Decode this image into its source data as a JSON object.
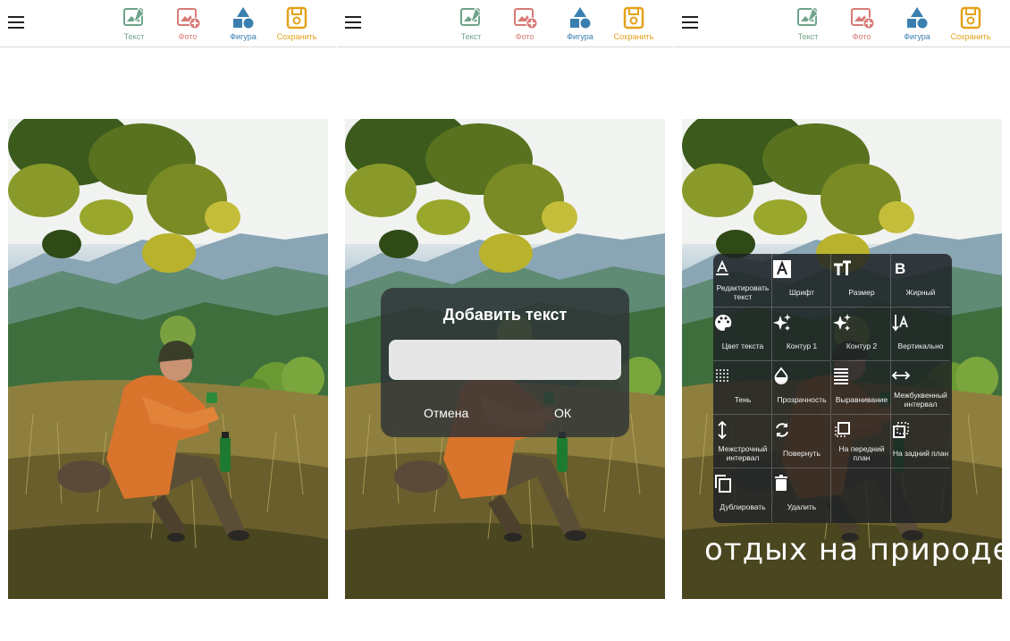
{
  "toolbar": {
    "text_label": "Текст",
    "photo_label": "Фото",
    "shape_label": "Фигура",
    "save_label": "Сохранить",
    "colors": {
      "text": "#6fa48a",
      "photo": "#d77b76",
      "shape": "#3a7fb0",
      "save": "#e3a21a"
    }
  },
  "dialog": {
    "title": "Добавить текст",
    "input_value": "",
    "cancel_label": "Отмена",
    "ok_label": "ОК"
  },
  "menu": {
    "items": [
      {
        "label": "Редактировать текст",
        "icon": "edit-text-icon"
      },
      {
        "label": "Шрифт",
        "icon": "font-icon"
      },
      {
        "label": "Размер",
        "icon": "text-size-icon"
      },
      {
        "label": "Жирный",
        "icon": "bold-icon"
      },
      {
        "label": "Цвет текста",
        "icon": "palette-icon"
      },
      {
        "label": "Контур 1",
        "icon": "sparkle-icon"
      },
      {
        "label": "Контур 2",
        "icon": "sparkle-icon"
      },
      {
        "label": "Вертикально",
        "icon": "vertical-text-icon"
      },
      {
        "label": "Тень",
        "icon": "shadow-icon"
      },
      {
        "label": "Прозрачность",
        "icon": "opacity-icon"
      },
      {
        "label": "Выравнивание",
        "icon": "align-icon"
      },
      {
        "label": "Межбуквенный интервал",
        "icon": "letter-spacing-icon"
      },
      {
        "label": "Межстрочный интервал",
        "icon": "line-spacing-icon"
      },
      {
        "label": "Повернуть",
        "icon": "rotate-icon"
      },
      {
        "label": "На передний план",
        "icon": "bring-front-icon"
      },
      {
        "label": "На задний план",
        "icon": "send-back-icon"
      },
      {
        "label": "Дублировать",
        "icon": "duplicate-icon"
      },
      {
        "label": "Удалить",
        "icon": "delete-icon"
      }
    ]
  },
  "overlay_text": "отдых на природе"
}
